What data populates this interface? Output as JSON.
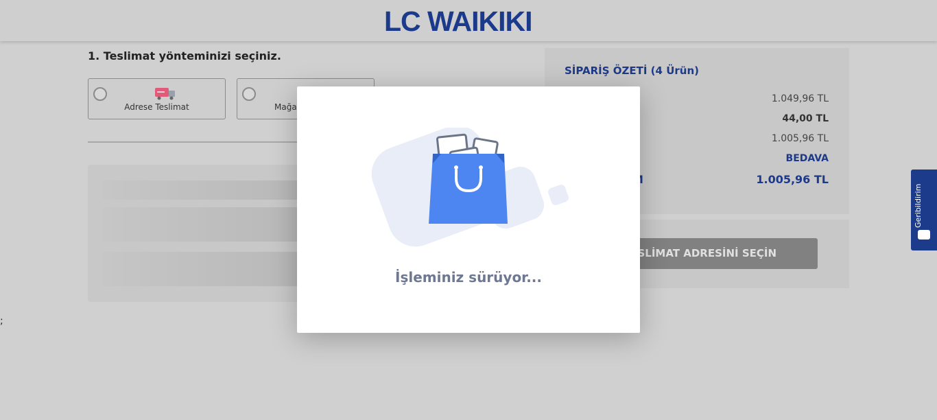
{
  "header": {
    "logo": "LC WAIKIKI"
  },
  "delivery": {
    "title": "1. Teslimat yönteminizi seçiniz.",
    "options": [
      {
        "label": "Adrese Teslimat"
      },
      {
        "label": "Mağaza"
      }
    ]
  },
  "summary": {
    "title": "SİPARİŞ ÖZETİ (4 Ürün)",
    "rows": [
      "1.049,96 TL",
      "44,00 TL",
      "1.005,96 TL",
      "BEDAVA"
    ],
    "total_label_partial": "M",
    "total_value": "1.005,96 TL",
    "button_label": "TESLİMAT ADRESİNİ SEÇİN"
  },
  "feedback": {
    "label": "Geribildirim"
  },
  "modal": {
    "message": "İşleminiz sürüyor..."
  },
  "misc": {
    "stray_char": ";"
  },
  "colors": {
    "brand_blue": "#1b3a8c",
    "bag_blue": "#4d86f0",
    "overlay_gray": "#d0d0d0"
  }
}
